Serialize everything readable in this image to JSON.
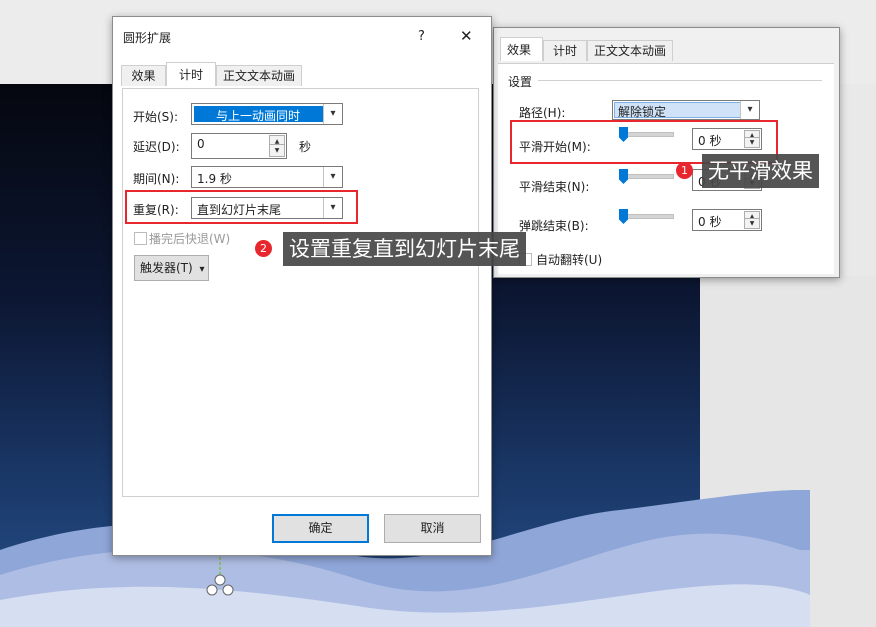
{
  "main_dialog": {
    "title": "圆形扩展",
    "help": "?",
    "close": "✕",
    "tabs": [
      "效果",
      "计时",
      "正文文本动画"
    ],
    "start_label": "开始(S):",
    "start_value": "与上一动画同时",
    "delay_label": "延迟(D):",
    "delay_value": "0",
    "delay_unit": "秒",
    "duration_label": "期间(N):",
    "duration_value": "1.9 秒",
    "repeat_label": "重复(R):",
    "repeat_value": "直到幻灯片末尾",
    "rewind_label": "播完后快退(W)",
    "trigger_label": "触发器(T)",
    "ok": "确定",
    "cancel": "取消"
  },
  "effect_dialog": {
    "tabs": [
      "效果",
      "计时",
      "正文文本动画"
    ],
    "group_label": "设置",
    "path_label": "路径(H):",
    "path_value": "解除锁定",
    "smooth_start_label": "平滑开始(M):",
    "smooth_start_value": "0 秒",
    "smooth_end_label": "平滑结束(N):",
    "smooth_end_value": "0 秒",
    "bounce_end_label": "弹跳结束(B):",
    "bounce_end_value": "0 秒",
    "auto_reverse_label": "自动翻转(U)"
  },
  "callouts": {
    "one_badge": "1",
    "one_text": "无平滑效果",
    "two_badge": "2",
    "two_text": "设置重复直到幻灯片末尾"
  },
  "colors": {
    "accent": "#0078d7",
    "highlight": "#e8262d",
    "slide_dark": "#05070f",
    "wave_light": "#c9d3ec",
    "wave_mid": "#8fa6d8"
  }
}
